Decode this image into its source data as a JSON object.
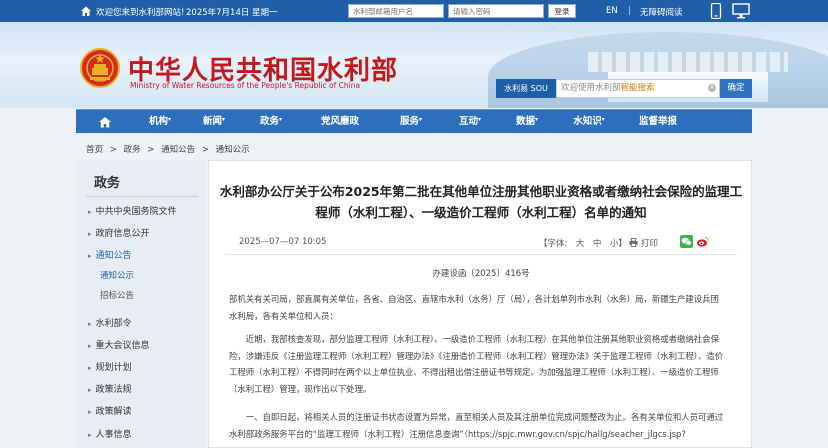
{
  "topbar": {
    "welcome": "欢迎您来到水利部网站!",
    "date": "2025年7月14日 星期一",
    "mail_placeholder": "水利部邮箱用户名",
    "password_placeholder": "请输入密码",
    "login_label": "登录",
    "lang_label": "EN",
    "separator": "|",
    "accessibility_label": "无障碍阅读"
  },
  "header": {
    "site_title": "中华人民共和国水利部",
    "site_subtitle": "Ministry of Water Resources of the People's Republic of China",
    "search_logo": "水利易 SOU",
    "search_placeholder_prefix": "欢迎使用水利部",
    "search_placeholder_highlight": "智能搜索",
    "search_button": "确定"
  },
  "nav": {
    "items": [
      {
        "label": "机构",
        "has_caret": true
      },
      {
        "label": "新闻",
        "has_caret": true
      },
      {
        "label": "政务",
        "has_caret": true
      },
      {
        "label": "党风廉政",
        "has_caret": false
      },
      {
        "label": "服务",
        "has_caret": true
      },
      {
        "label": "互动",
        "has_caret": true
      },
      {
        "label": "数据",
        "has_caret": true
      },
      {
        "label": "水知识",
        "has_caret": true
      },
      {
        "label": "监督举报",
        "has_caret": false
      }
    ],
    "caret": "▾"
  },
  "breadcrumb": [
    "首页",
    ">",
    "政务",
    ">",
    "通知公告",
    ">",
    "通知公示"
  ],
  "sidebar": {
    "title": "政务",
    "arrow": "▸",
    "items": [
      {
        "label": "中共中央国务院文件"
      },
      {
        "label": "政府信息公开"
      },
      {
        "label": "通知公告",
        "active": true
      },
      {
        "label": "水利部令",
        "is_sub": false
      },
      {
        "label": "重大会议信息"
      },
      {
        "label": "规划计划"
      },
      {
        "label": "政策法规"
      },
      {
        "label": "政策解读"
      },
      {
        "label": "人事信息"
      }
    ],
    "sub_items": [
      {
        "label": "通知公示",
        "active": true
      },
      {
        "label": "招标公告",
        "active": false
      }
    ]
  },
  "article": {
    "title": "水利部办公厅关于公布2025年第二批在其他单位注册其他职业资格或者缴纳社会保险的监理工程师（水利工程）、一级造价工程师（水利工程）名单的通知",
    "date": "2025—07—07 10:05",
    "font_label": "【字体:　大　中　小】",
    "print_label": "打印",
    "doc_number": "办建设函〔2025〕416号",
    "paragraphs": [
      "部机关有关司局，部直属有关单位，各省、自治区、直辖市水利（水务）厅（局），各计划单列市水利（水务）局，新疆生产建设兵团水利局，各有关单位和人员：",
      "　　近期，我部核查发现，部分监理工程师（水利工程）、一级造价工程师（水利工程）在其他单位注册其他职业资格或者缴纳社会保险，涉嫌违反《注册监理工程师（水利工程）管理办法》《注册造价工程师（水利工程）管理办法》关于监理工程师（水利工程）、造价工程师（水利工程）不得同时在两个以上单位执业、不得出租出借注册证书等规定。为加强监理工程师（水利工程）、一级造价工程师（水利工程）管理，现作出以下处理。",
      "　　一、自即日起，将相关人员的注册证书状态设置为异常，直至相关人员及其注册单位完成问题整改为止。各有关单位和人员可通过水利部政务服务平台的“监理工程师（水利工程）注册信息查询”（https://spjc.mwr.gov.cn/spjc/hallg/seacher_jlgcs.jsp?"
    ]
  },
  "colors": {
    "brand_blue": "#1e5fa8",
    "nav_blue": "#2e6fbd",
    "title_red": "#c8161d",
    "highlight_orange": "#e07a00"
  },
  "icons": [
    "home-icon",
    "mobile-icon",
    "desktop-icon",
    "national-emblem-icon",
    "clear-icon",
    "print-icon",
    "wechat-icon",
    "weibo-icon"
  ]
}
